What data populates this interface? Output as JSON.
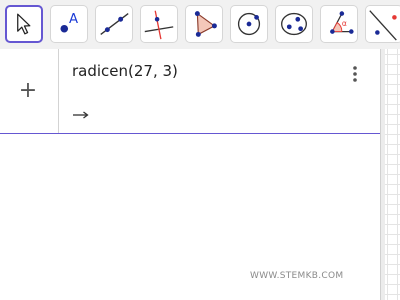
{
  "toolbar": {
    "tools": [
      {
        "name": "move-tool",
        "icon": "cursor-arrow-icon",
        "selected": true
      },
      {
        "name": "point-tool",
        "icon": "point-a-icon",
        "label": "A"
      },
      {
        "name": "line-tool",
        "icon": "line-through-two-points-icon"
      },
      {
        "name": "perpendicular-line-tool",
        "icon": "perpendicular-line-icon"
      },
      {
        "name": "polygon-tool",
        "icon": "polygon-icon"
      },
      {
        "name": "circle-center-point-tool",
        "icon": "circle-with-center-icon"
      },
      {
        "name": "ellipse-tool",
        "icon": "ellipse-icon"
      },
      {
        "name": "angle-tool",
        "icon": "angle-alpha-icon",
        "label": "α"
      },
      {
        "name": "reflect-tool",
        "icon": "reflect-line-icon"
      }
    ]
  },
  "algebra": {
    "add_symbol": "+",
    "input": "radicen(27, 3)",
    "menu_icon": "more-vertical-icon",
    "output_icon": "right-arrow-icon",
    "output_value": ""
  },
  "watermark": "WWW.STEMKB.COM",
  "colors": {
    "accent": "#6557d2",
    "point_blue": "#1a2a96",
    "polygon_fill": "#f4c7b9",
    "red_line": "#e53935"
  }
}
